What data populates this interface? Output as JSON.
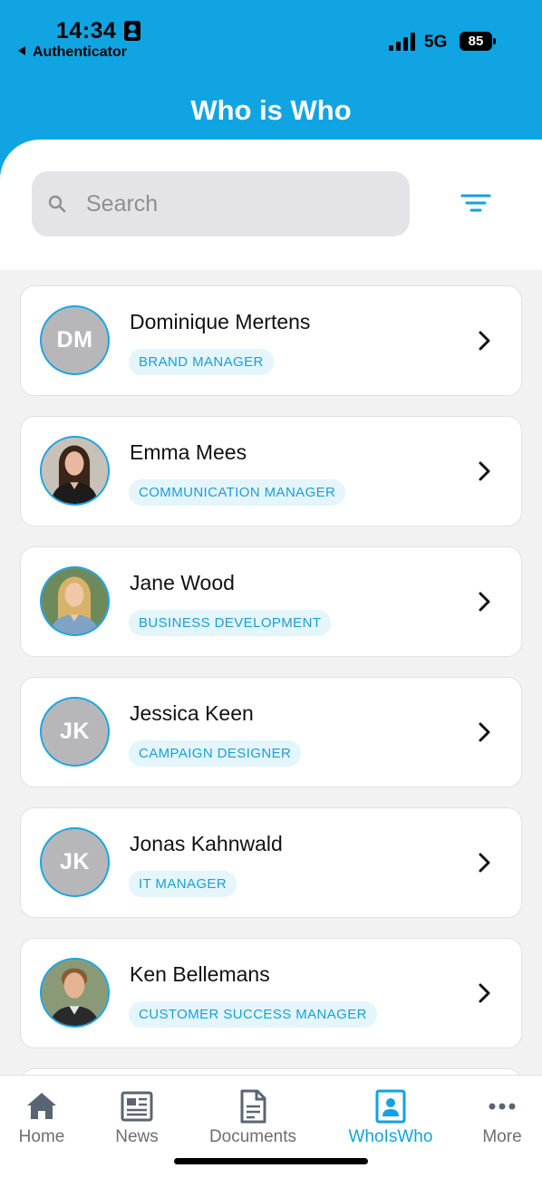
{
  "status_bar": {
    "time": "14:34",
    "back_app": "Authenticator",
    "network": "5G",
    "battery": "85"
  },
  "header": {
    "title": "Who is Who"
  },
  "search": {
    "placeholder": "Search",
    "value": ""
  },
  "people": [
    {
      "name": "Dominique Mertens",
      "role": "BRAND MANAGER",
      "initials": "DM",
      "photo": false
    },
    {
      "name": "Emma Mees",
      "role": "COMMUNICATION MANAGER",
      "initials": "",
      "photo": true
    },
    {
      "name": "Jane Wood",
      "role": "BUSINESS DEVELOPMENT",
      "initials": "",
      "photo": true
    },
    {
      "name": "Jessica Keen",
      "role": "CAMPAIGN DESIGNER",
      "initials": "JK",
      "photo": false
    },
    {
      "name": "Jonas Kahnwald",
      "role": "IT MANAGER",
      "initials": "JK",
      "photo": false
    },
    {
      "name": "Ken Bellemans",
      "role": "CUSTOMER SUCCESS MANAGER",
      "initials": "",
      "photo": true
    }
  ],
  "tabs": [
    {
      "label": "Home",
      "icon": "home-icon",
      "active": false
    },
    {
      "label": "News",
      "icon": "news-icon",
      "active": false
    },
    {
      "label": "Documents",
      "icon": "document-icon",
      "active": false
    },
    {
      "label": "WhoIsWho",
      "icon": "contact-card-icon",
      "active": true
    },
    {
      "label": "More",
      "icon": "more-dots-icon",
      "active": false
    }
  ],
  "colors": {
    "accent": "#10a4e2",
    "chip_bg": "#e4f5fc",
    "chip_text": "#1a9fd8",
    "inactive_tab": "#6e6e73"
  }
}
